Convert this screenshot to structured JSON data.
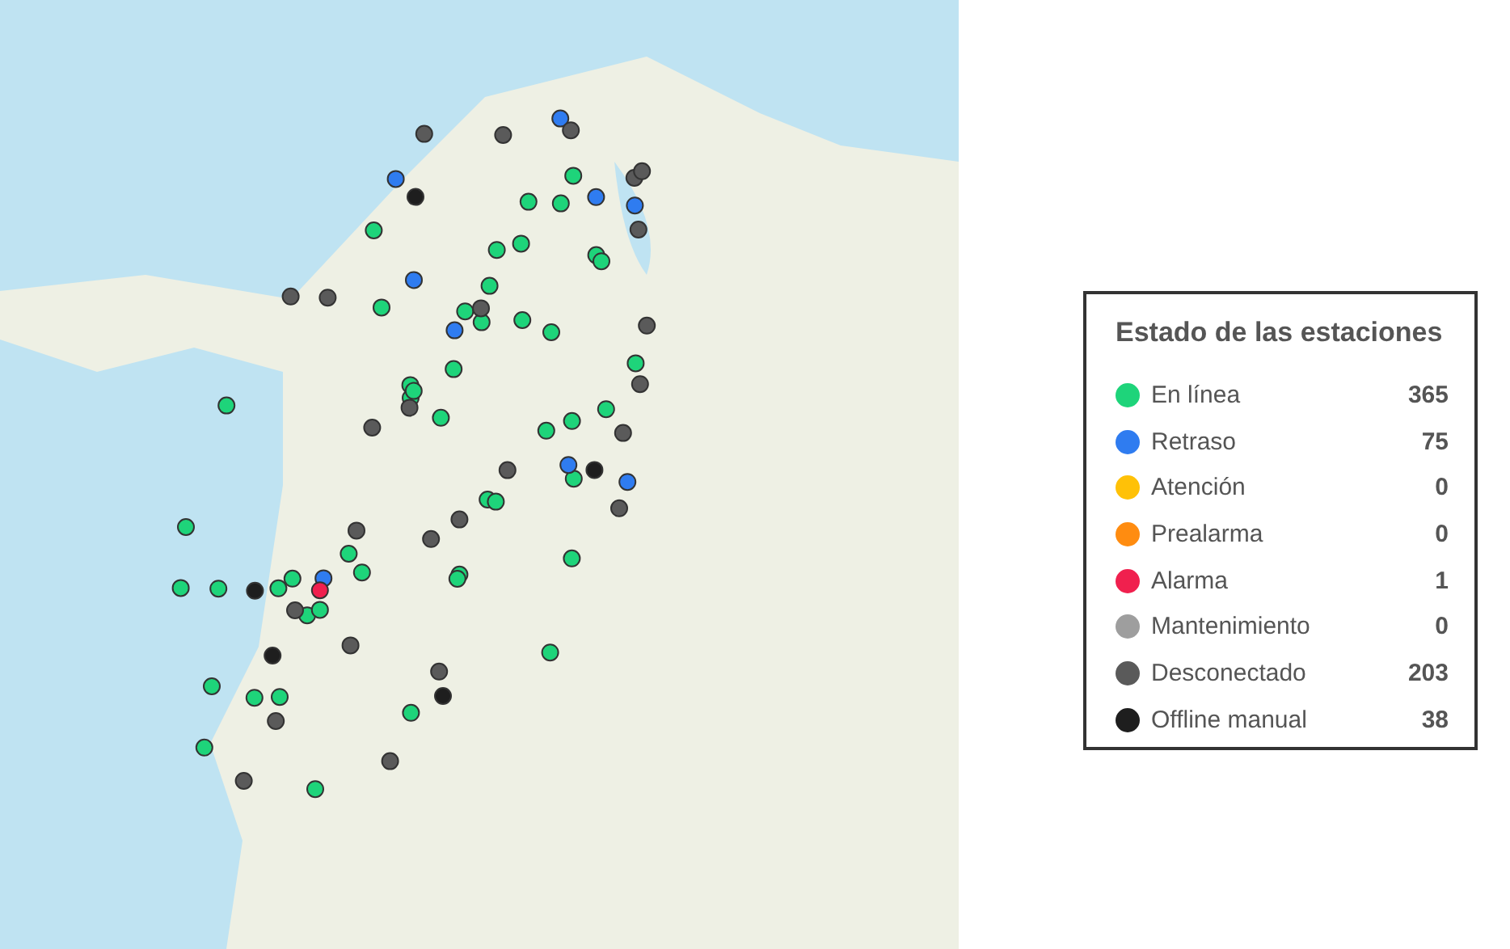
{
  "legend": {
    "title": "Estado de las estaciones",
    "items": [
      {
        "label": "En línea",
        "count": "365",
        "color": "#1ed47a"
      },
      {
        "label": "Retraso",
        "count": "75",
        "color": "#2f7cf0"
      },
      {
        "label": "Atención",
        "count": "0",
        "color": "#ffc107"
      },
      {
        "label": "Prealarma",
        "count": "0",
        "color": "#ff8c10"
      },
      {
        "label": "Alarma",
        "count": "1",
        "color": "#f0204e"
      },
      {
        "label": "Mantenimiento",
        "count": "0",
        "color": "#9e9e9e"
      },
      {
        "label": "Desconectado",
        "count": "203",
        "color": "#5a5a5a"
      },
      {
        "label": "Offline manual",
        "count": "38",
        "color": "#1e1e1e"
      }
    ]
  }
}
